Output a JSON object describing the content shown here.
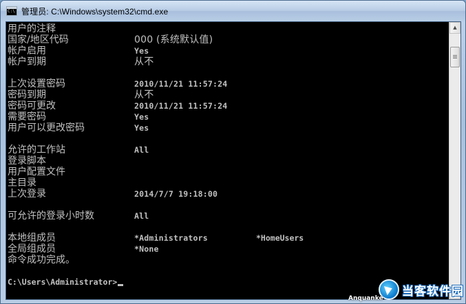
{
  "window": {
    "title": "管理员: C:\\Windows\\system32\\cmd.exe"
  },
  "console": {
    "lines": [
      {
        "label": "用户的注释",
        "value": ""
      },
      {
        "label": "国家/地区代码",
        "value": "000 (系统默认值)"
      },
      {
        "label": "帐户启用",
        "value": "Yes"
      },
      {
        "label": "帐户到期",
        "value": "从不"
      },
      {
        "label": "",
        "value": ""
      },
      {
        "label": "上次设置密码",
        "value": "2010/11/21 11:57:24"
      },
      {
        "label": "密码到期",
        "value": "从不"
      },
      {
        "label": "密码可更改",
        "value": "2010/11/21 11:57:24"
      },
      {
        "label": "需要密码",
        "value": "Yes"
      },
      {
        "label": "用户可以更改密码",
        "value": "Yes"
      },
      {
        "label": "",
        "value": ""
      },
      {
        "label": "允许的工作站",
        "value": "All"
      },
      {
        "label": "登录脚本",
        "value": ""
      },
      {
        "label": "用户配置文件",
        "value": ""
      },
      {
        "label": "主目录",
        "value": ""
      },
      {
        "label": "上次登录",
        "value": "2014/7/7 19:18:00"
      },
      {
        "label": "",
        "value": ""
      },
      {
        "label": "可允许的登录小时数",
        "value": "All"
      },
      {
        "label": "",
        "value": ""
      },
      {
        "label": "本地组成员",
        "value": "*Administrators",
        "value2": "*HomeUsers"
      },
      {
        "label": "全局组成员",
        "value": "*None"
      },
      {
        "label": "命令成功完成。",
        "value": ""
      }
    ],
    "prompt": "C:\\Users\\Administrator>"
  },
  "watermark": {
    "brand": "当客软件园",
    "sub": "Anquanke"
  },
  "colors": {
    "console_bg": "#000000",
    "console_text": "#c0c0c0",
    "titlebar": "#b9cee6"
  }
}
